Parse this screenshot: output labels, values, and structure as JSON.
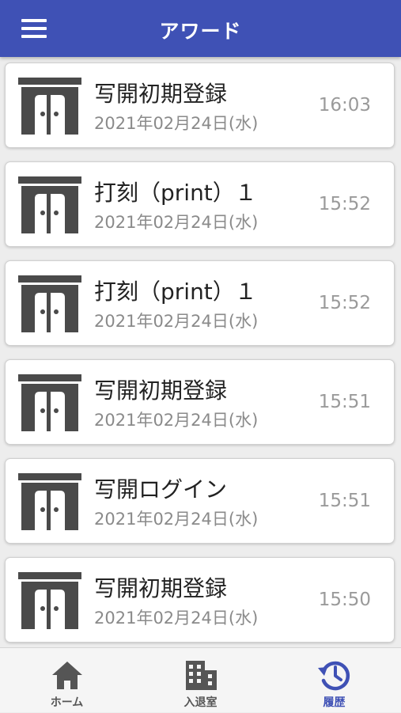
{
  "header": {
    "title": "アワード",
    "menu_icon": "hamburger-menu-icon"
  },
  "colors": {
    "appbar": "#3f51b5",
    "accent": "#3f51b5",
    "icon_gray": "#4a4a4a"
  },
  "history": [
    {
      "title": "写開初期登録",
      "date": "2021年02月24日(水)",
      "time": "16:03"
    },
    {
      "title": "打刻（print）１",
      "date": "2021年02月24日(水)",
      "time": "15:52"
    },
    {
      "title": "打刻（print）１",
      "date": "2021年02月24日(水)",
      "time": "15:52"
    },
    {
      "title": "写開初期登録",
      "date": "2021年02月24日(水)",
      "time": "15:51"
    },
    {
      "title": "写開ログイン",
      "date": "2021年02月24日(水)",
      "time": "15:51"
    },
    {
      "title": "写開初期登録",
      "date": "2021年02月24日(水)",
      "time": "15:50"
    }
  ],
  "bottom_nav": {
    "home": {
      "label": "ホーム",
      "icon": "home-icon"
    },
    "entry": {
      "label": "入退室",
      "icon": "building-icon"
    },
    "history": {
      "label": "履歴",
      "icon": "history-icon",
      "active": true
    }
  }
}
